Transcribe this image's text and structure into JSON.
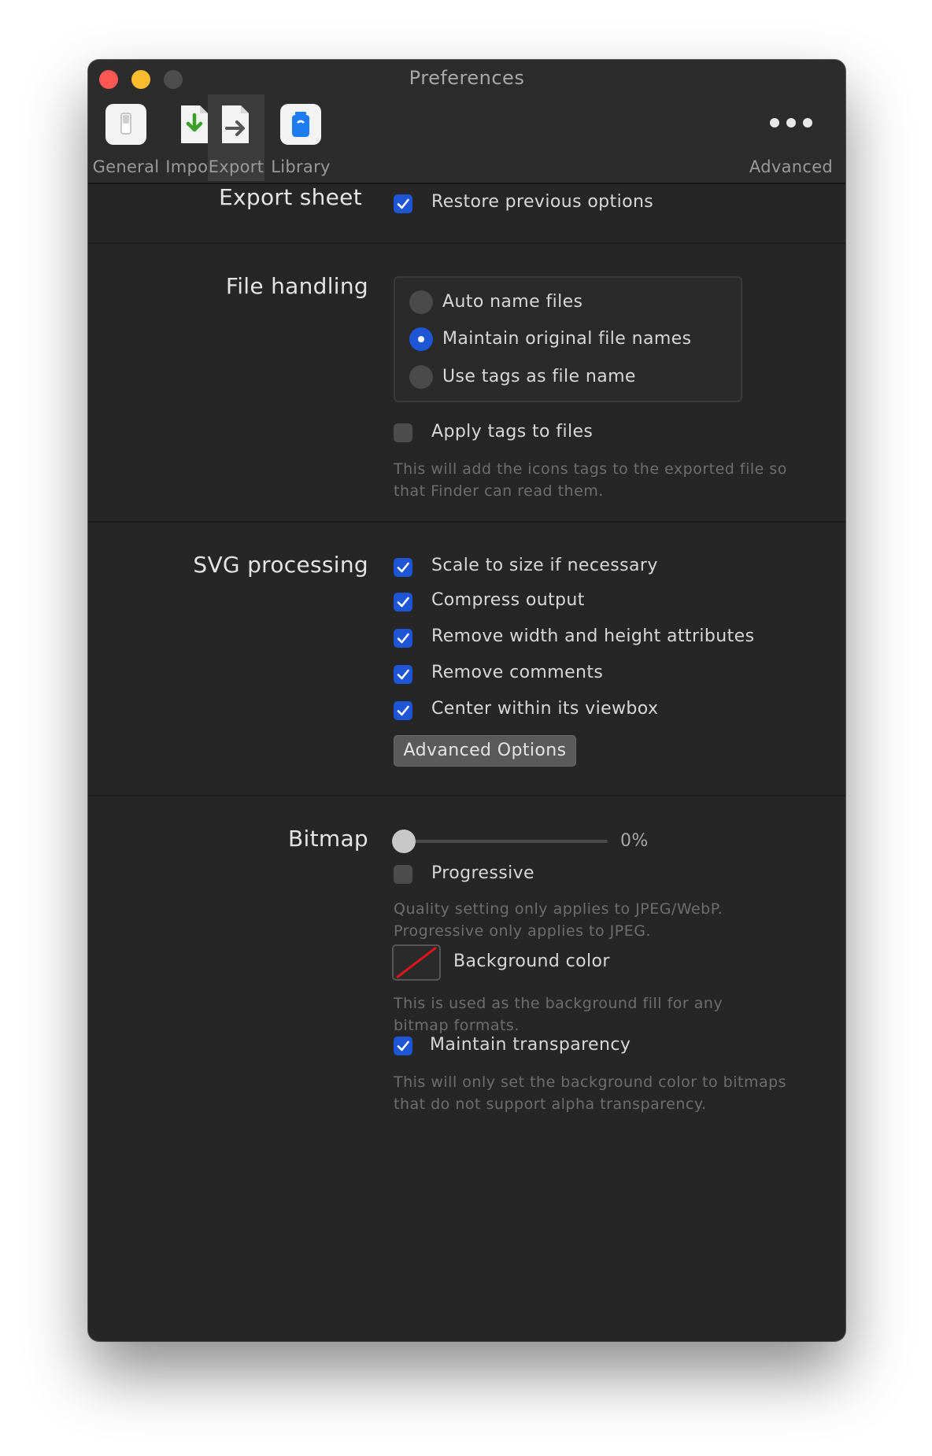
{
  "window": {
    "title": "Preferences"
  },
  "toolbar": {
    "items": [
      {
        "label": "General",
        "icon": "switch-icon"
      },
      {
        "label": "Import",
        "icon": "import-arrow-icon"
      },
      {
        "label": "Export",
        "icon": "export-arrow-icon",
        "active": true
      },
      {
        "label": "Library",
        "icon": "jar-icon"
      }
    ],
    "advanced_label": "Advanced"
  },
  "export_sheet": {
    "title": "Export sheet",
    "restore_label": "Restore previous options",
    "restore_checked": true
  },
  "file_handling": {
    "title": "File handling",
    "options": [
      {
        "label": "Auto name files",
        "selected": false
      },
      {
        "label": "Maintain original file names",
        "selected": true
      },
      {
        "label": "Use tags as file name",
        "selected": false
      }
    ],
    "apply_tags_label": "Apply tags to files",
    "apply_tags_checked": false,
    "apply_tags_hint_line1": "This will add the icons tags to the exported file so",
    "apply_tags_hint_line2": "that Finder can read them."
  },
  "svg_processing": {
    "title": "SVG processing",
    "options": [
      {
        "label": "Scale to size if necessary",
        "checked": true
      },
      {
        "label": "Compress output",
        "checked": true
      },
      {
        "label": "Remove width and height attributes",
        "checked": true
      },
      {
        "label": "Remove comments",
        "checked": true
      },
      {
        "label": "Center within its viewbox",
        "checked": true
      }
    ],
    "advanced_button": "Advanced Options"
  },
  "bitmap": {
    "title": "Bitmap",
    "quality_value": "0%",
    "quality_fraction": 0,
    "progressive_label": "Progressive",
    "progressive_checked": false,
    "quality_hint_line1": "Quality setting only applies to JPEG/WebP.",
    "quality_hint_line2": "Progressive only applies to JPEG.",
    "background_label": "Background color",
    "background_hint_line1": "This is used as the background fill for any",
    "background_hint_line2": "bitmap formats.",
    "transparency_label": "Maintain transparency",
    "transparency_checked": true,
    "transparency_hint_line1": "This will only set the background color to bitmaps",
    "transparency_hint_line2": "that do not support alpha transparency."
  },
  "colors": {
    "accent": "#1e56d6",
    "window_bg": "#262626",
    "close": "#fc5753",
    "minimize": "#fdbc2e"
  }
}
